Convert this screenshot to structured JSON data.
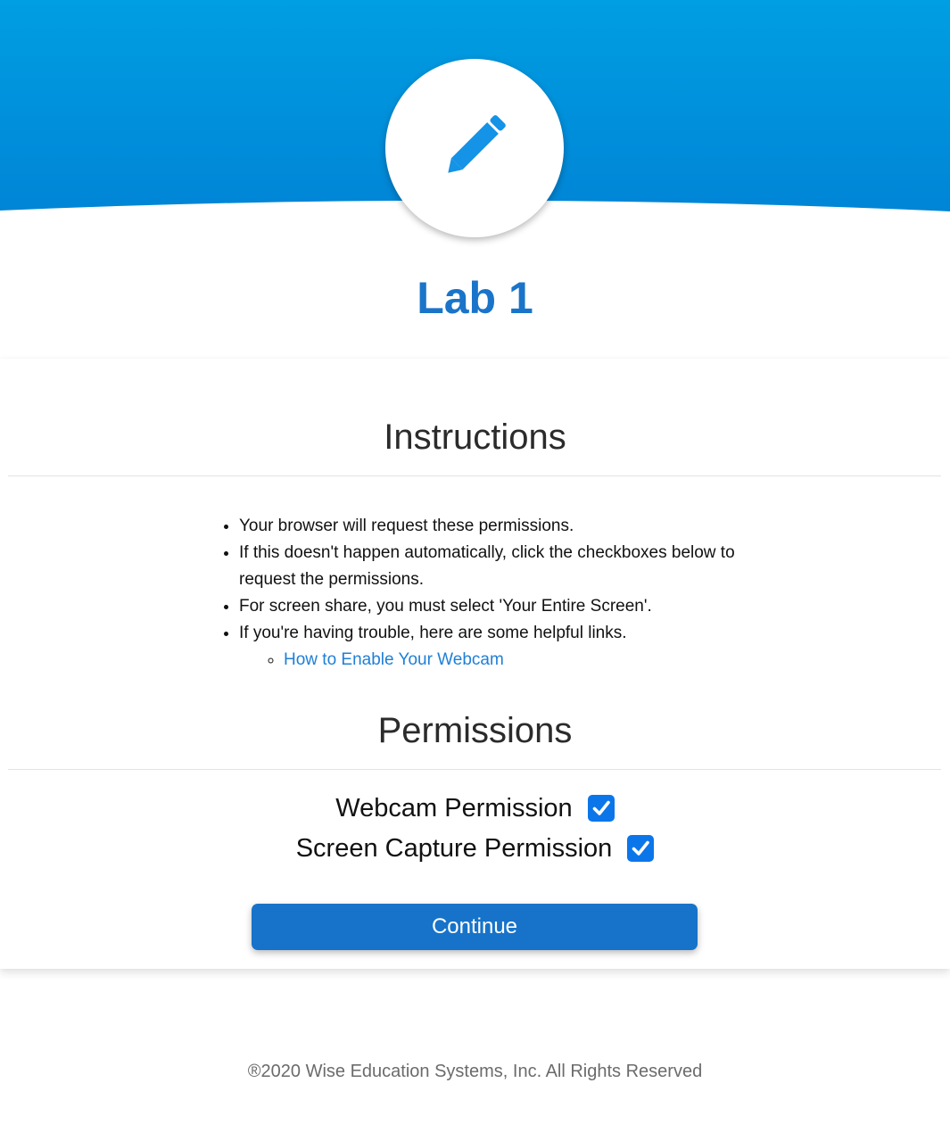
{
  "header": {
    "icon": "pencil-icon",
    "title": "Lab 1"
  },
  "instructions": {
    "heading": "Instructions",
    "items": [
      "Your browser will request these permissions.",
      "If this doesn't happen automatically, click the checkboxes below to request the permissions.",
      "For screen share, you must select 'Your Entire Screen'.",
      "If you're having trouble, here are some helpful links."
    ],
    "links": [
      "How to Enable Your Webcam"
    ]
  },
  "permissions": {
    "heading": "Permissions",
    "items": [
      {
        "label": "Webcam Permission",
        "checked": true
      },
      {
        "label": "Screen Capture Permission",
        "checked": true
      }
    ]
  },
  "actions": {
    "continue_label": "Continue"
  },
  "footer": {
    "text": "®2020 Wise Education Systems, Inc. All Rights Reserved"
  },
  "colors": {
    "header_gradient_top": "#009ee2",
    "header_gradient_bottom": "#0085d6",
    "title": "#1a74c9",
    "button": "#1773c9",
    "checkbox": "#0b76ea",
    "link": "#1f7fd6"
  }
}
